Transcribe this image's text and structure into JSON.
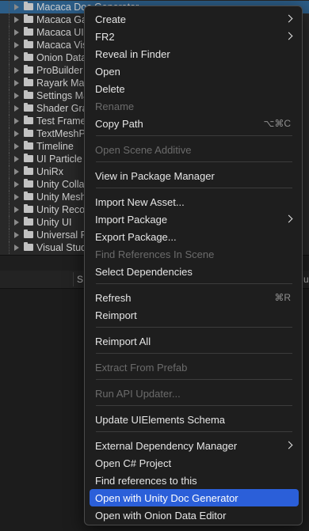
{
  "tree": {
    "items": [
      {
        "label": "Macaca Doc Generator",
        "selected": true
      },
      {
        "label": "Macaca GameView",
        "selected": false
      },
      {
        "label": "Macaca UI",
        "selected": false
      },
      {
        "label": "Macaca Visual",
        "selected": false
      },
      {
        "label": "Onion Data Editor",
        "selected": false
      },
      {
        "label": "ProBuilder",
        "selected": false
      },
      {
        "label": "Rayark Mast",
        "selected": false
      },
      {
        "label": "Settings Manager",
        "selected": false
      },
      {
        "label": "Shader Graph",
        "selected": false
      },
      {
        "label": "Test Framework",
        "selected": false
      },
      {
        "label": "TextMeshPro",
        "selected": false
      },
      {
        "label": "Timeline",
        "selected": false
      },
      {
        "label": "UI Particle",
        "selected": false
      },
      {
        "label": "UniRx",
        "selected": false
      },
      {
        "label": "Unity Collab",
        "selected": false
      },
      {
        "label": "Unity Mesh",
        "selected": false
      },
      {
        "label": "Unity Recorder",
        "selected": false
      },
      {
        "label": "Unity UI",
        "selected": false
      },
      {
        "label": "Universal RP",
        "selected": false
      },
      {
        "label": "Visual Studio",
        "selected": false
      }
    ]
  },
  "bottom_panel": {
    "col_left_label": "S",
    "col_right_label": "u"
  },
  "menu": {
    "items": [
      {
        "label": "Create",
        "submenu": true
      },
      {
        "label": "FR2",
        "submenu": true
      },
      {
        "label": "Reveal in Finder"
      },
      {
        "label": "Open"
      },
      {
        "label": "Delete"
      },
      {
        "label": "Rename",
        "disabled": true
      },
      {
        "label": "Copy Path",
        "shortcut": "⌥⌘C"
      },
      {
        "label": "Open Scene Additive",
        "disabled": true
      },
      {
        "label": "View in Package Manager"
      },
      {
        "label": "Import New Asset..."
      },
      {
        "label": "Import Package",
        "submenu": true
      },
      {
        "label": "Export Package..."
      },
      {
        "label": "Find References In Scene",
        "disabled": true
      },
      {
        "label": "Select Dependencies"
      },
      {
        "label": "Refresh",
        "shortcut": "⌘R"
      },
      {
        "label": "Reimport"
      },
      {
        "label": "Reimport All"
      },
      {
        "label": "Extract From Prefab",
        "disabled": true
      },
      {
        "label": "Run API Updater...",
        "disabled": true
      },
      {
        "label": "Update UIElements Schema"
      },
      {
        "label": "External Dependency Manager",
        "submenu": true
      },
      {
        "label": "Open C# Project"
      },
      {
        "label": "Find references to this"
      },
      {
        "label": "Open with Unity Doc Generator",
        "highlighted": true
      },
      {
        "label": "Open with Onion Data Editor"
      }
    ]
  },
  "colors": {
    "menu_bg": "#1e1e1e",
    "highlight": "#2b5fd9",
    "tree_selection": "#2c5d87",
    "disabled_text": "#6b6b6b"
  }
}
